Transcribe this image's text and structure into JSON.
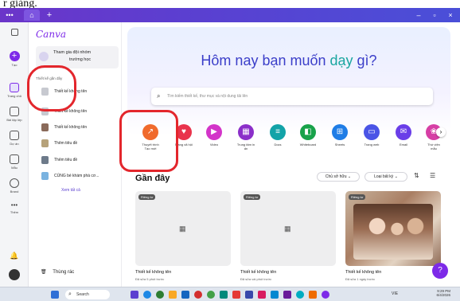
{
  "caption": "r giảng.",
  "window": {
    "tab_home_icon": "home-icon",
    "controls": [
      "–",
      "▫",
      "×"
    ]
  },
  "rail": {
    "create_label": "Tạo",
    "items": [
      {
        "label": "Trang chủ",
        "icon": "home-icon"
      },
      {
        "label": "Bài tập lớp",
        "icon": "assignment-icon"
      },
      {
        "label": "Dự án",
        "icon": "folder-icon"
      },
      {
        "label": "Mẫu",
        "icon": "template-icon"
      },
      {
        "label": "Brand",
        "icon": "brand-icon"
      },
      {
        "label": "Thêm",
        "icon": "more-icon"
      }
    ]
  },
  "side": {
    "logo": "Canva",
    "team_line1": "Tham gia đội nhóm",
    "team_line2": "trường học",
    "section_label": "Thiết kế gần đây",
    "items": [
      {
        "label": "Thiết kế không tên"
      },
      {
        "label": "Thiết kế không tên"
      },
      {
        "label": "Thiết kế không tên"
      },
      {
        "label": "Thêm tiêu đề"
      },
      {
        "label": "Thêm tiêu đề"
      },
      {
        "label": "CÙNG bé khám phá cơ..."
      }
    ],
    "see_all": "Xem tất cả",
    "trash": "Thùng rác"
  },
  "hero": {
    "title_pre": "Hôm nay bạn muốn ",
    "title_word": "dạy",
    "title_post": " gì?",
    "search_placeholder": "Tìm kiếm thiết kế, thư mục và nội dung tải lên"
  },
  "categories": [
    {
      "label": "Thuyết trình",
      "sub": "Tạo mới",
      "color": "#f06a2c",
      "icon": "presentation-icon"
    },
    {
      "label": "Mạng xã hội",
      "sub": "",
      "color": "#e9334c",
      "icon": "heart-icon"
    },
    {
      "label": "Video",
      "sub": "",
      "color": "#d334c9",
      "icon": "video-icon"
    },
    {
      "label": "Trung tâm in",
      "sub": "ấn",
      "color": "#8b2fc9",
      "icon": "print-icon"
    },
    {
      "label": "Docs",
      "sub": "",
      "color": "#13a3a8",
      "icon": "docs-icon"
    },
    {
      "label": "Whiteboard",
      "sub": "",
      "color": "#18a24a",
      "icon": "whiteboard-icon"
    },
    {
      "label": "Sheets",
      "sub": "",
      "color": "#1f7de6",
      "icon": "sheets-icon"
    },
    {
      "label": "Trang web",
      "sub": "",
      "color": "#4a54e6",
      "icon": "web-icon"
    },
    {
      "label": "Email",
      "sub": "",
      "color": "#6a3ee8",
      "icon": "email-icon"
    },
    {
      "label": "Thứ viện",
      "sub": "mẫu",
      "color": "#d63ea5",
      "icon": "library-icon"
    }
  ],
  "recent": {
    "heading": "Gần đây",
    "owner_filter": "Chủ sở hữu",
    "type_filter": "Loại bất kỳ",
    "cards": [
      {
        "badge": "Riêng tư",
        "title": "Thiết kế không tên",
        "sub": "Đã sửa 5 phút trước"
      },
      {
        "badge": "Riêng tư",
        "title": "Thiết kế không tên",
        "sub": "Đã sửa vài phút trước"
      },
      {
        "badge": "Riêng tư",
        "title": "Thiết kế không tên",
        "sub": "Đã sửa 1 ngày trước"
      }
    ]
  },
  "taskbar": {
    "search": "Search",
    "time": "9:29 PM",
    "date": "6/4/2026",
    "lang": "VIE"
  }
}
